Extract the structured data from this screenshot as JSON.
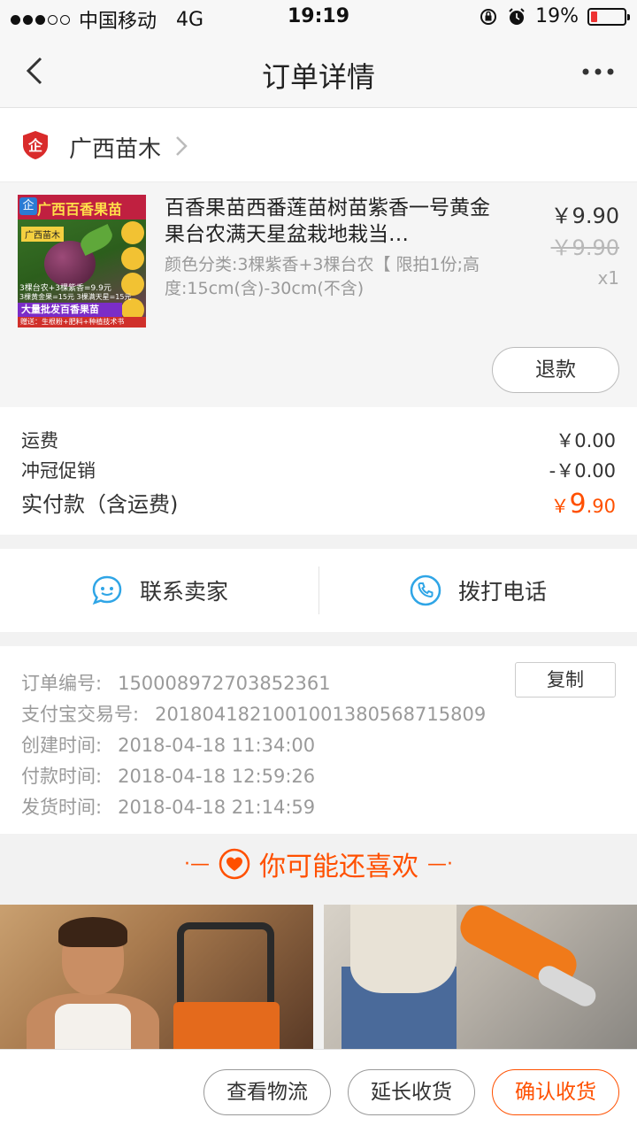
{
  "status_bar": {
    "carrier": "中国移动",
    "network": "4G",
    "time": "19:19",
    "battery": "19%",
    "battery_level": 0.19
  },
  "nav": {
    "title": "订单详情",
    "back_icon": "chevron-left-icon",
    "more_icon": "more-dots-icon"
  },
  "shop": {
    "name": "广西苗木",
    "icon": "enterprise-shop-icon"
  },
  "product": {
    "title": "百香果苗西番莲苗树苗紫香一号黄金果台农满天星盆栽地栽当…",
    "spec": "颜色分类:3棵紫香+3棵台农【 限拍1份;高度:15cm(含)-30cm(不含)",
    "price": "￥9.90",
    "original_price": "￥9.90",
    "quantity": "x1",
    "refund_label": "退款",
    "thumb": {
      "badge": "企",
      "title": "广西百香果苗",
      "tag": "广西苗木",
      "line1": "3棵台农+3棵紫香=9.9元",
      "line2": "3棵黄金果=15元  3棵满天星=15元",
      "bar": "大量批发百香果苗",
      "foot": "赠送：生根粉+肥料+种植技术书"
    }
  },
  "fees": {
    "shipping_label": "运费",
    "shipping_value": "￥0.00",
    "promo_label": "冲冠促销",
    "promo_value": "-￥0.00",
    "paid_label": "实付款（含运费)",
    "paid_currency": "￥",
    "paid_integer": "9",
    "paid_decimal": ".90",
    "accent": "#ff5000"
  },
  "contact": {
    "seller_label": "联系卖家",
    "phone_label": "拨打电话",
    "icon_color": "#2fa5e6"
  },
  "order_info": {
    "copy_label": "复制",
    "rows": [
      {
        "label": "订单编号:",
        "value": "150008972703852361"
      },
      {
        "label": "支付宝交易号:",
        "value": "2018041821001001380568715809"
      },
      {
        "label": "创建时间:",
        "value": "2018-04-18 11:34:00"
      },
      {
        "label": "付款时间:",
        "value": "2018-04-18 12:59:26"
      },
      {
        "label": "发货时间:",
        "value": "2018-04-18 21:14:59"
      }
    ]
  },
  "recommend": {
    "title": "你可能还喜欢",
    "deco_left": "·—",
    "deco_right": "—·"
  },
  "bottom": {
    "logistics_label": "查看物流",
    "extend_label": "延长收货",
    "confirm_label": "确认收货"
  }
}
